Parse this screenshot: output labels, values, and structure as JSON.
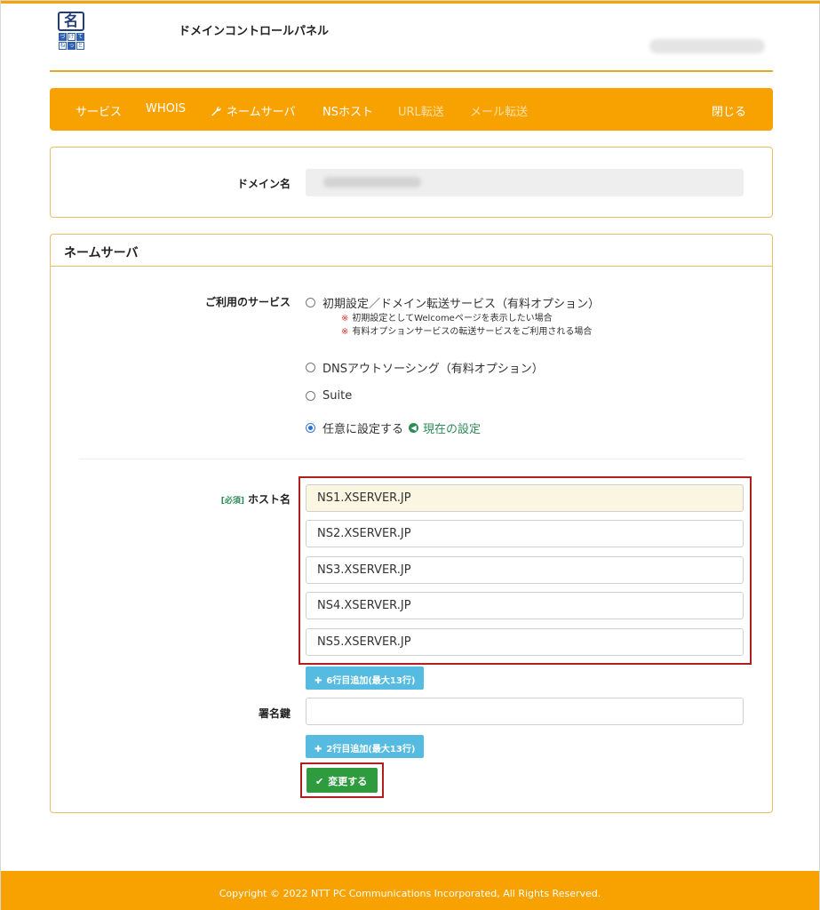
{
  "header": {
    "logo_char": "名",
    "logo_sub": [
      "づ",
      "け",
      "て",
      "ね",
      "っ",
      "と"
    ],
    "title": "ドメインコントロールパネル"
  },
  "nav": {
    "items": [
      {
        "label": "サービス"
      },
      {
        "label": "WHOIS"
      },
      {
        "label": "ネームサーバ"
      },
      {
        "label": "NSホスト"
      },
      {
        "label": "URL転送"
      },
      {
        "label": "メール転送"
      }
    ],
    "close_label": "閉じる"
  },
  "domain_panel": {
    "label": "ドメイン名"
  },
  "ns_panel": {
    "title": "ネームサーバ",
    "service_label": "ご利用のサービス",
    "options": [
      {
        "label": "初期設定／ドメイン転送サービス（有料オプション）",
        "checked": false
      },
      {
        "label": "DNSアウトソーシング（有料オプション）",
        "checked": false
      },
      {
        "label": "Suite",
        "checked": false
      },
      {
        "label": "任意に設定する",
        "checked": true
      }
    ],
    "notes": [
      "初期設定としてWelcomeページを表示したい場合",
      "有料オプションサービスの転送サービスをご利用される場合"
    ],
    "note_mark": "※",
    "current_setting_label": "現在の設定",
    "required_tag": "[必須]",
    "host_label": "ホスト名",
    "hosts": [
      "NS1.XSERVER.JP",
      "NS2.XSERVER.JP",
      "NS3.XSERVER.JP",
      "NS4.XSERVER.JP",
      "NS5.XSERVER.JP"
    ],
    "add_host_rows_label": "6行目追加(最大13行)",
    "signature_label": "署名鍵",
    "signature_value": "",
    "add_sig_rows_label": "2行目追加(最大13行)",
    "submit_label": "変更する"
  },
  "footer": {
    "copyright": "Copyright © 2022 NTT PC Communications Incorporated, All Rights Reserved."
  },
  "colors": {
    "accent": "#f7a200",
    "highlight": "#b01e1e",
    "info_button": "#56bbe0",
    "submit_button": "#2e9b3f"
  }
}
